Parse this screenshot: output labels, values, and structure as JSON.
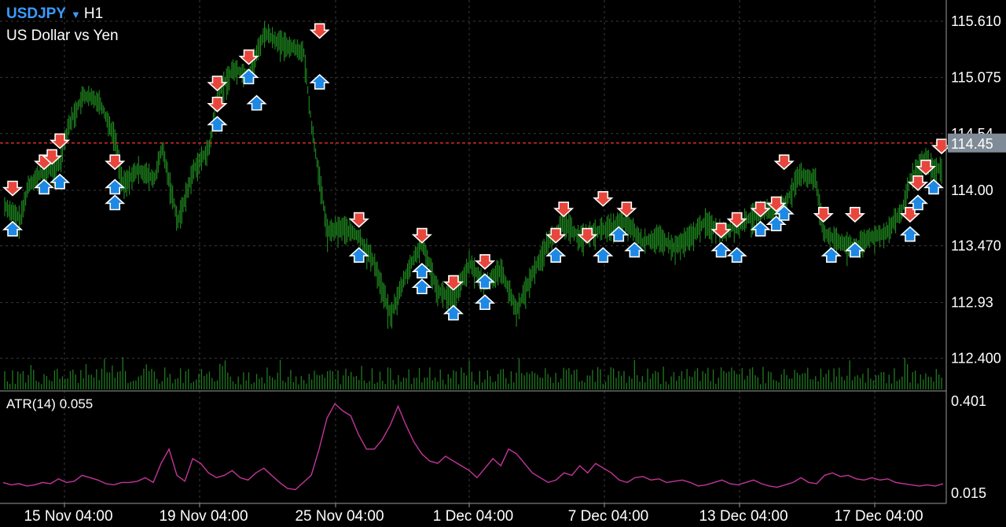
{
  "header": {
    "symbol": "USDJPY",
    "dropdown_icon": "triangle-down-icon",
    "timeframe": "H1",
    "description": "US Dollar vs Yen"
  },
  "colors": {
    "background": "#000000",
    "grid": "#3a3a3a",
    "candles": "#1f8a1f",
    "volume": "#1f7a1f",
    "atr_line": "#c2359a",
    "current_price_line": "#e03030",
    "current_price_tag_bg": "#7f8c97",
    "sell_arrow": "#e8463c",
    "buy_arrow": "#1e88e5",
    "symbol_text": "#3b9bff"
  },
  "chart_data": [
    {
      "type": "candlestick",
      "symbol": "USDJPY",
      "timeframe": "H1",
      "ylim": [
        112.2,
        115.7
      ],
      "price_ticks": [
        "115.610",
        "115.075",
        "114.54",
        "114.00",
        "113.470",
        "112.93",
        "112.400"
      ],
      "current_price": "114.45",
      "time_ticks": [
        "15 Nov 04:00",
        "19 Nov 04:00",
        "25 Nov 04:00",
        "1 Dec 04:00",
        "7 Dec 04:00",
        "13 Dec 04:00",
        "17 Dec 04:00"
      ],
      "price_path": [
        [
          0,
          113.85
        ],
        [
          2,
          113.72
        ],
        [
          3,
          114.05
        ],
        [
          5,
          114.18
        ],
        [
          7,
          114.25
        ],
        [
          8,
          114.6
        ],
        [
          10,
          114.9
        ],
        [
          12,
          114.85
        ],
        [
          14,
          114.5
        ],
        [
          15,
          114.05
        ],
        [
          17,
          114.2
        ],
        [
          19,
          114.1
        ],
        [
          20,
          114.4
        ],
        [
          22,
          113.7
        ],
        [
          24,
          114.2
        ],
        [
          26,
          114.4
        ],
        [
          27,
          114.9
        ],
        [
          29,
          115.15
        ],
        [
          31,
          115.1
        ],
        [
          33,
          115.5
        ],
        [
          35,
          115.4
        ],
        [
          37,
          115.35
        ],
        [
          38,
          115.3
        ],
        [
          39,
          114.6
        ],
        [
          41,
          113.6
        ],
        [
          43,
          113.65
        ],
        [
          45,
          113.55
        ],
        [
          47,
          113.3
        ],
        [
          49,
          112.8
        ],
        [
          51,
          113.2
        ],
        [
          53,
          113.5
        ],
        [
          55,
          113.05
        ],
        [
          57,
          112.95
        ],
        [
          59,
          113.3
        ],
        [
          61,
          113.1
        ],
        [
          63,
          113.25
        ],
        [
          65,
          112.85
        ],
        [
          67,
          113.2
        ],
        [
          69,
          113.5
        ],
        [
          71,
          113.7
        ],
        [
          73,
          113.55
        ],
        [
          75,
          113.6
        ],
        [
          77,
          113.65
        ],
        [
          79,
          113.7
        ],
        [
          81,
          113.5
        ],
        [
          83,
          113.55
        ],
        [
          85,
          113.45
        ],
        [
          87,
          113.55
        ],
        [
          89,
          113.7
        ],
        [
          91,
          113.6
        ],
        [
          93,
          113.65
        ],
        [
          95,
          113.75
        ],
        [
          97,
          113.8
        ],
        [
          99,
          113.85
        ],
        [
          101,
          114.15
        ],
        [
          103,
          114.1
        ],
        [
          104,
          113.6
        ],
        [
          106,
          113.5
        ],
        [
          108,
          113.45
        ],
        [
          110,
          113.55
        ],
        [
          112,
          113.6
        ],
        [
          114,
          113.8
        ],
        [
          115,
          114.1
        ],
        [
          117,
          114.3
        ],
        [
          118,
          114.2
        ]
      ],
      "trade_markers": [
        {
          "bar": 1,
          "price": 113.95,
          "side": "sell"
        },
        {
          "bar": 1,
          "price": 113.7,
          "side": "buy"
        },
        {
          "bar": 5,
          "price": 114.2,
          "side": "sell"
        },
        {
          "bar": 6,
          "price": 114.25,
          "side": "sell"
        },
        {
          "bar": 7,
          "price": 114.4,
          "side": "sell"
        },
        {
          "bar": 5,
          "price": 114.1,
          "side": "buy"
        },
        {
          "bar": 7,
          "price": 114.15,
          "side": "buy"
        },
        {
          "bar": 14,
          "price": 114.2,
          "side": "sell"
        },
        {
          "bar": 14,
          "price": 114.1,
          "side": "buy"
        },
        {
          "bar": 14,
          "price": 113.95,
          "side": "buy"
        },
        {
          "bar": 27,
          "price": 114.95,
          "side": "sell"
        },
        {
          "bar": 27,
          "price": 114.75,
          "side": "sell"
        },
        {
          "bar": 27,
          "price": 114.7,
          "side": "buy"
        },
        {
          "bar": 31,
          "price": 115.2,
          "side": "sell"
        },
        {
          "bar": 31,
          "price": 115.15,
          "side": "buy"
        },
        {
          "bar": 32,
          "price": 114.9,
          "side": "buy"
        },
        {
          "bar": 40,
          "price": 115.45,
          "side": "sell"
        },
        {
          "bar": 40,
          "price": 115.1,
          "side": "buy"
        },
        {
          "bar": 45,
          "price": 113.65,
          "side": "sell"
        },
        {
          "bar": 45,
          "price": 113.45,
          "side": "buy"
        },
        {
          "bar": 53,
          "price": 113.5,
          "side": "sell"
        },
        {
          "bar": 53,
          "price": 113.3,
          "side": "buy"
        },
        {
          "bar": 53,
          "price": 113.15,
          "side": "buy"
        },
        {
          "bar": 57,
          "price": 113.05,
          "side": "sell"
        },
        {
          "bar": 57,
          "price": 112.9,
          "side": "buy"
        },
        {
          "bar": 61,
          "price": 113.25,
          "side": "sell"
        },
        {
          "bar": 61,
          "price": 113.2,
          "side": "buy"
        },
        {
          "bar": 61,
          "price": 113.0,
          "side": "buy"
        },
        {
          "bar": 70,
          "price": 113.5,
          "side": "sell"
        },
        {
          "bar": 71,
          "price": 113.75,
          "side": "sell"
        },
        {
          "bar": 70,
          "price": 113.45,
          "side": "buy"
        },
        {
          "bar": 74,
          "price": 113.5,
          "side": "sell"
        },
        {
          "bar": 76,
          "price": 113.85,
          "side": "sell"
        },
        {
          "bar": 76,
          "price": 113.45,
          "side": "buy"
        },
        {
          "bar": 79,
          "price": 113.75,
          "side": "sell"
        },
        {
          "bar": 78,
          "price": 113.65,
          "side": "buy"
        },
        {
          "bar": 80,
          "price": 113.5,
          "side": "buy"
        },
        {
          "bar": 91,
          "price": 113.55,
          "side": "sell"
        },
        {
          "bar": 93,
          "price": 113.65,
          "side": "sell"
        },
        {
          "bar": 91,
          "price": 113.5,
          "side": "buy"
        },
        {
          "bar": 93,
          "price": 113.45,
          "side": "buy"
        },
        {
          "bar": 96,
          "price": 113.75,
          "side": "sell"
        },
        {
          "bar": 98,
          "price": 113.8,
          "side": "sell"
        },
        {
          "bar": 96,
          "price": 113.7,
          "side": "buy"
        },
        {
          "bar": 98,
          "price": 113.75,
          "side": "buy"
        },
        {
          "bar": 99,
          "price": 114.2,
          "side": "sell"
        },
        {
          "bar": 99,
          "price": 113.85,
          "side": "buy"
        },
        {
          "bar": 104,
          "price": 113.7,
          "side": "sell"
        },
        {
          "bar": 105,
          "price": 113.45,
          "side": "buy"
        },
        {
          "bar": 108,
          "price": 113.7,
          "side": "sell"
        },
        {
          "bar": 108,
          "price": 113.5,
          "side": "buy"
        },
        {
          "bar": 115,
          "price": 113.7,
          "side": "sell"
        },
        {
          "bar": 115,
          "price": 113.65,
          "side": "buy"
        },
        {
          "bar": 116,
          "price": 114.0,
          "side": "sell"
        },
        {
          "bar": 117,
          "price": 114.15,
          "side": "sell"
        },
        {
          "bar": 116,
          "price": 113.95,
          "side": "buy"
        },
        {
          "bar": 118,
          "price": 114.1,
          "side": "buy"
        },
        {
          "bar": 119,
          "price": 114.35,
          "side": "sell"
        }
      ]
    },
    {
      "type": "line",
      "title": "ATR(14) 0.055",
      "ylim": [
        0.015,
        0.401
      ],
      "price_ticks": [
        "0.401",
        "0.015"
      ],
      "values": [
        0.06,
        0.05,
        0.055,
        0.045,
        0.05,
        0.06,
        0.055,
        0.075,
        0.06,
        0.065,
        0.09,
        0.08,
        0.07,
        0.055,
        0.05,
        0.06,
        0.06,
        0.065,
        0.08,
        0.06,
        0.14,
        0.2,
        0.09,
        0.065,
        0.16,
        0.14,
        0.1,
        0.08,
        0.09,
        0.11,
        0.08,
        0.07,
        0.1,
        0.12,
        0.09,
        0.06,
        0.035,
        0.03,
        0.06,
        0.09,
        0.2,
        0.33,
        0.39,
        0.36,
        0.34,
        0.26,
        0.2,
        0.2,
        0.24,
        0.3,
        0.38,
        0.3,
        0.23,
        0.18,
        0.15,
        0.14,
        0.17,
        0.15,
        0.13,
        0.11,
        0.08,
        0.12,
        0.16,
        0.13,
        0.2,
        0.18,
        0.14,
        0.1,
        0.08,
        0.06,
        0.07,
        0.1,
        0.09,
        0.13,
        0.1,
        0.14,
        0.12,
        0.1,
        0.07,
        0.06,
        0.08,
        0.085,
        0.07,
        0.075,
        0.06,
        0.065,
        0.07,
        0.06,
        0.045,
        0.05,
        0.06,
        0.07,
        0.055,
        0.05,
        0.06,
        0.07,
        0.055,
        0.045,
        0.04,
        0.05,
        0.06,
        0.08,
        0.06,
        0.055,
        0.09,
        0.1,
        0.085,
        0.09,
        0.075,
        0.07,
        0.08,
        0.07,
        0.075,
        0.06,
        0.055,
        0.05,
        0.045,
        0.05,
        0.045,
        0.055
      ]
    }
  ]
}
